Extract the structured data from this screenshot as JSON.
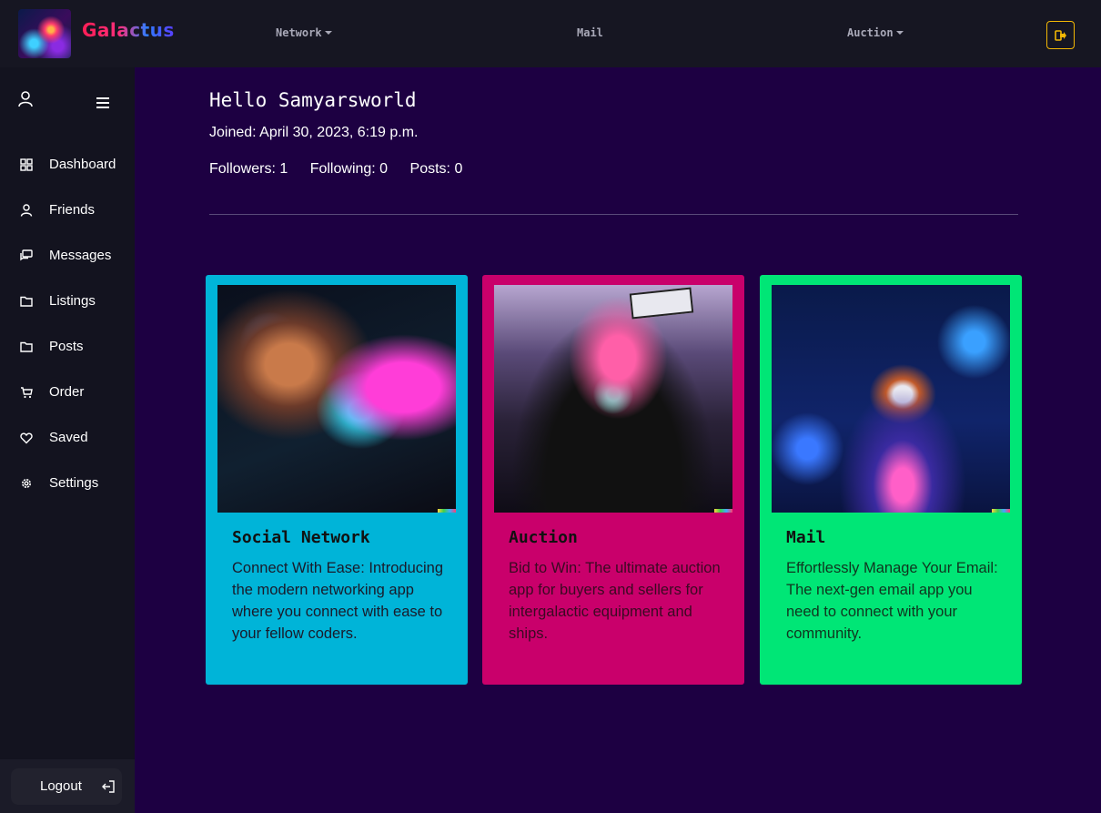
{
  "brand": {
    "name": "Galactus"
  },
  "topnav": {
    "items": [
      {
        "label": "Network",
        "dropdown": true
      },
      {
        "label": "Mail",
        "dropdown": false
      },
      {
        "label": "Auction",
        "dropdown": true
      }
    ],
    "exit_icon": "sign-out-icon"
  },
  "sidebar": {
    "items": [
      {
        "label": "Dashboard",
        "icon": "grid-icon"
      },
      {
        "label": "Friends",
        "icon": "user-icon"
      },
      {
        "label": "Messages",
        "icon": "chat-icon"
      },
      {
        "label": "Listings",
        "icon": "folder-icon"
      },
      {
        "label": "Posts",
        "icon": "folder-icon"
      },
      {
        "label": "Order",
        "icon": "cart-icon"
      },
      {
        "label": "Saved",
        "icon": "heart-icon"
      },
      {
        "label": "Settings",
        "icon": "gear-icon"
      }
    ],
    "logout_label": "Logout"
  },
  "profile": {
    "greeting": "Hello Samyarsworld",
    "joined": "Joined: April 30, 2023, 6:19 p.m.",
    "followers": "Followers: 1",
    "following": "Following: 0",
    "posts": "Posts: 0"
  },
  "cards": [
    {
      "title": "Social Network",
      "description": "Connect With Ease: Introducing the modern networking app where you connect with ease to your fellow coders.",
      "color": "#00b4d8"
    },
    {
      "title": "Auction",
      "description": "Bid to Win: The ultimate auction app for buyers and sellers for intergalactic equipment and ships.",
      "color": "#c9006b"
    },
    {
      "title": "Mail",
      "description": "Effortlessly Manage Your Email: The next-gen email app you need to connect with your community.",
      "color": "#00e676"
    }
  ],
  "colors": {
    "page_bg": "#1d0042",
    "topbar_bg": "#161622",
    "sidebar_bg": "#13131f",
    "exit_button_border": "#f2b705"
  }
}
